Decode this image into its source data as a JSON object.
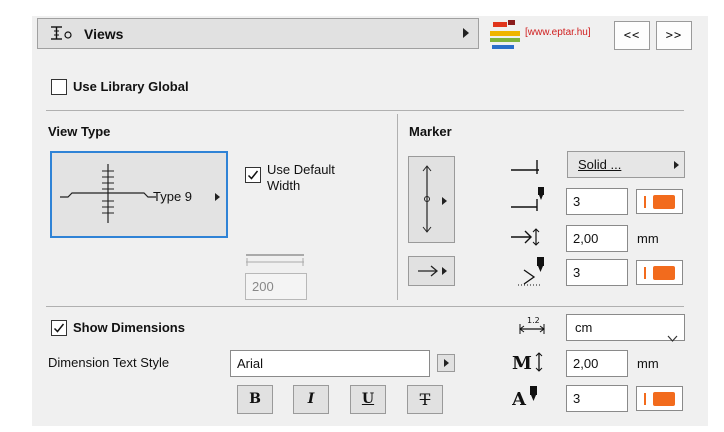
{
  "header": {
    "title": "Views",
    "logo_text": "[www.eptar.hu]",
    "prev_label": "<<",
    "next_label": ">>"
  },
  "use_library_global": {
    "label": "Use Library Global",
    "checked": false
  },
  "view_type": {
    "heading": "View Type",
    "selected": "Type 9",
    "use_default_width_line1": "Use Default",
    "use_default_width_line2": "Width",
    "use_default_width_checked": true,
    "width_value": "200"
  },
  "marker": {
    "heading": "Marker",
    "line_type": "Solid ...",
    "pen_1": "3",
    "size": "2,00",
    "size_unit": "mm",
    "pen_2": "3"
  },
  "dimensions": {
    "show_label": "Show Dimensions",
    "show_checked": true,
    "text_style_label": "Dimension Text Style",
    "font": "Arial",
    "unit": "cm",
    "text_size": "2,00",
    "text_size_unit": "mm",
    "text_pen": "3",
    "bold_label": "B",
    "italic_label": "I",
    "underline_label": "U",
    "strike_label": "T"
  },
  "colors": {
    "accent": "#2f83d6",
    "pen": "#f26b1d"
  }
}
